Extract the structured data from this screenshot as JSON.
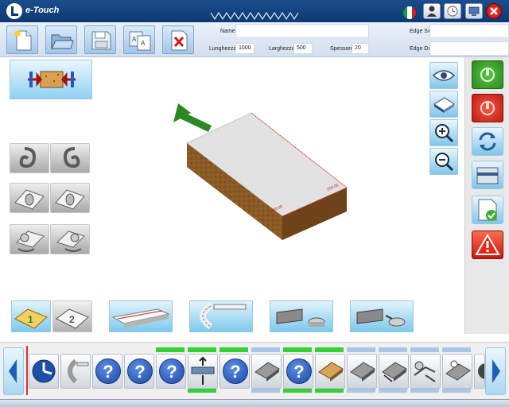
{
  "app": {
    "title": "e-Touch",
    "language_flag": "italian-flag-icon"
  },
  "titlebar_buttons": [
    {
      "name": "operator-button",
      "icon": "user-icon"
    },
    {
      "name": "clock-button",
      "icon": "clock-icon"
    },
    {
      "name": "network-button",
      "icon": "monitor-icon"
    },
    {
      "name": "close-app-button",
      "icon": "close-icon"
    }
  ],
  "toolbar": {
    "buttons": [
      {
        "name": "new-project-button",
        "icon": "new-file-icon"
      },
      {
        "name": "open-project-button",
        "icon": "open-folder-icon"
      },
      {
        "name": "save-project-button",
        "icon": "save-disk-icon"
      },
      {
        "name": "save-as-button",
        "icon": "save-as-icon"
      },
      {
        "name": "delete-project-button",
        "icon": "delete-icon"
      }
    ],
    "fields": {
      "name": {
        "label": "Name",
        "value": ""
      },
      "length": {
        "label": "Lunghezza",
        "value": "1000"
      },
      "width": {
        "label": "Larghezza",
        "value": "500"
      },
      "thickness": {
        "label": "Spessore",
        "value": "20"
      },
      "edge_sx": {
        "label": "Edge Sx",
        "value": ""
      },
      "edge_dx": {
        "label": "Edge Dx",
        "value": ""
      }
    }
  },
  "viewer": {
    "panel_dimension_labels": [
      "1000.00",
      "500.00"
    ]
  },
  "colors": {
    "accent_blue": "#1a4d8c",
    "button_blue": "#7fc6ea",
    "start_green": "#3a9a2a",
    "stop_red": "#d83020",
    "warning_red": "#e02a1a",
    "progress_green": "#35d035",
    "progress_blue": "#a9c6e8"
  }
}
